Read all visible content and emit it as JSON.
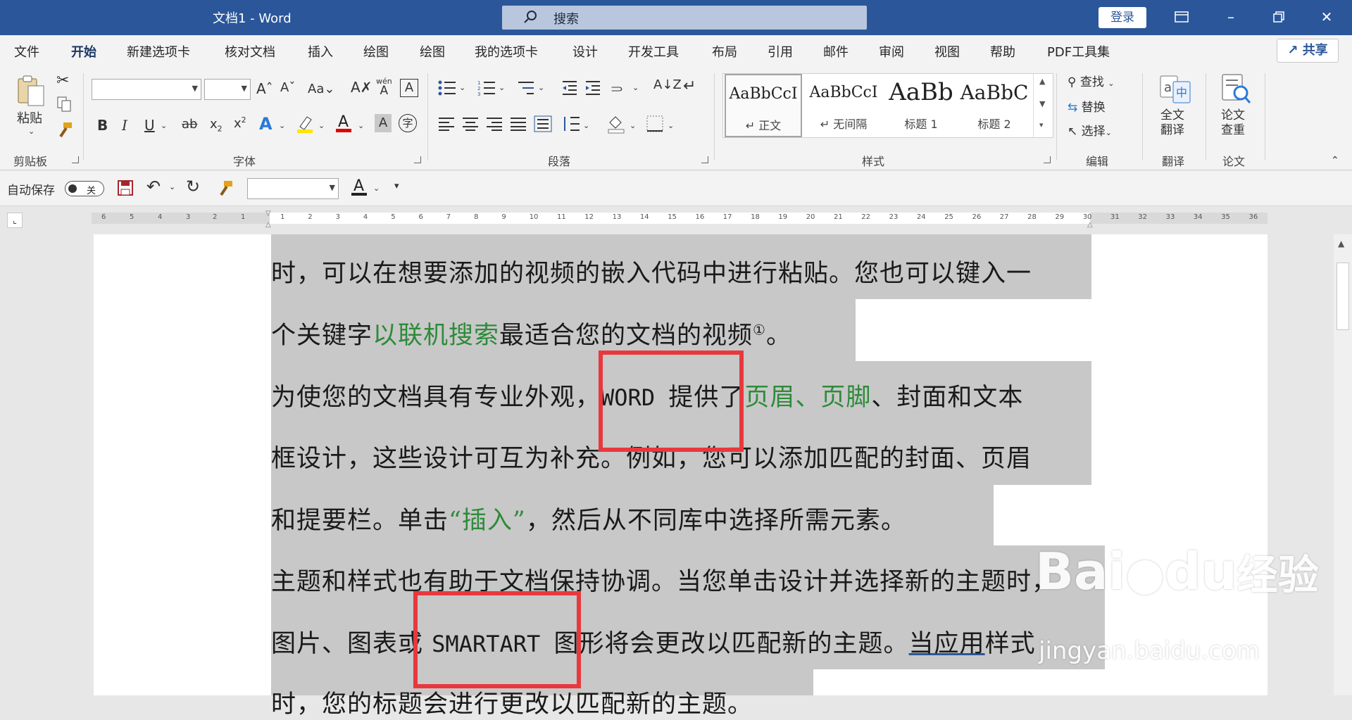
{
  "titlebar": {
    "doc_title": "文档1  -  Word",
    "search_placeholder": "搜索",
    "login": "登录"
  },
  "tabs": [
    "文件",
    "开始",
    "新建选项卡",
    "核对文档",
    "插入",
    "绘图",
    "绘图",
    "我的选项卡",
    "设计",
    "开发工具",
    "布局",
    "引用",
    "邮件",
    "审阅",
    "视图",
    "帮助",
    "PDF工具集"
  ],
  "active_tab": "开始",
  "share": "共享",
  "ribbon": {
    "clipboard": {
      "paste": "粘贴",
      "label": "剪贴板"
    },
    "font": {
      "label": "字体",
      "change_case": "Aa",
      "pinyin_top": "wén",
      "pinyin_char": "A",
      "text_A": "A"
    },
    "paragraph": {
      "label": "段落"
    },
    "styles": {
      "label": "样式",
      "items": [
        {
          "preview": "AaBbCcI",
          "name": "↵ 正文"
        },
        {
          "preview": "AaBbCcI",
          "name": "↵ 无间隔"
        },
        {
          "preview": "AaBb",
          "name": "标题 1"
        },
        {
          "preview": "AaBbC",
          "name": "标题 2"
        }
      ]
    },
    "editing": {
      "find": "查找",
      "replace": "替换",
      "select": "选择",
      "label": "编辑"
    },
    "translate": {
      "full": "全文\n翻译",
      "full_l1": "全文",
      "full_l2": "翻译",
      "label": "翻译"
    },
    "paper": {
      "l1": "论文",
      "l2": "查重",
      "label": "论文"
    }
  },
  "qat": {
    "autosave": "自动保存",
    "toggle": "关"
  },
  "ruler": {
    "left": [
      "6",
      "5",
      "4",
      "3",
      "2",
      "1"
    ],
    "right": [
      "1",
      "2",
      "3",
      "4",
      "5",
      "6",
      "7",
      "8",
      "9",
      "10",
      "11",
      "12",
      "13",
      "14",
      "15",
      "16",
      "17",
      "18",
      "19",
      "20",
      "21",
      "22",
      "23",
      "24",
      "25",
      "26",
      "27",
      "28",
      "29",
      "30",
      "31",
      "32",
      "33",
      "34",
      "35",
      "36"
    ]
  },
  "document": {
    "l1": "时，可以在想要添加的视频的嵌入代码中进行粘贴。您也可以键入一",
    "l2a": "个关键字",
    "l2b": "以联机搜索",
    "l2c": "最适合您的文档的视频",
    "l2sup": "①",
    "l2d": "。",
    "l3a": "为使您的文档具有专业外观，",
    "l3b": "WORD ",
    "l3c": "提供了",
    "l3d": "页眉、页脚",
    "l3e": "、封面和文本",
    "l4": "框设计，这些设计可互为补充。例如，您可以添加匹配的封面、页眉",
    "l5a": "和提要栏。单击",
    "l5b": "“插入”",
    "l5c": "，然后从不同库中选择所需元素。",
    "l6": "主题和样式也有助于文档保持协调。当您单击设计并选择新的主题时，",
    "l7a": "图片、图表或 ",
    "l7b": "SMARTART ",
    "l7c": "图形将会更改以匹配新的主题。",
    "l7d": "当应用",
    "l7e": "样式",
    "l8": "时，您的标题会进行更改以匹配新的主题。"
  },
  "watermark": {
    "brand": "Bai",
    "brand2": "du",
    "suffix": "经验",
    "url": "jingyan.baidu.com"
  }
}
